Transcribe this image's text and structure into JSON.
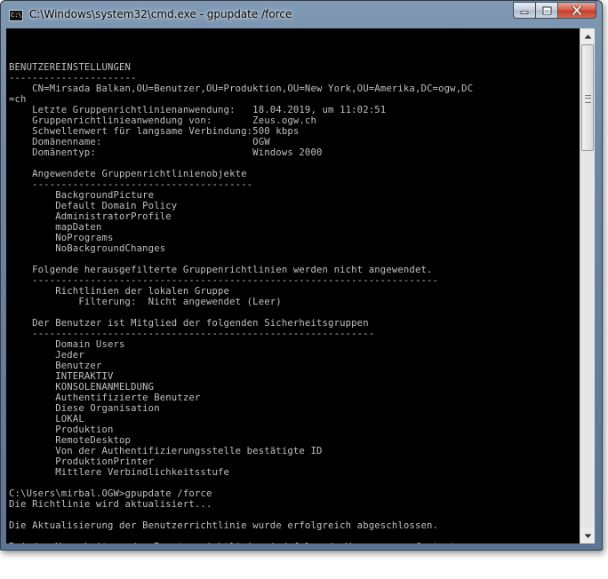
{
  "window": {
    "title": "C:\\Windows\\system32\\cmd.exe - gpupdate  /force",
    "icon": "C:\\",
    "buttons": {
      "minimize": "minimize-icon",
      "maximize": "maximize-icon",
      "close": "close-icon"
    }
  },
  "console": {
    "lines": [
      "",
      "",
      "",
      "BENUTZEREINSTELLUNGEN",
      "----------------------",
      "    CN=Mirsada Balkan,OU=Benutzer,OU=Produktion,OU=New York,OU=Amerika,DC=ogw,DC",
      "=ch",
      "    Letzte Gruppenrichtlinienanwendung:   18.04.2019, um 11:02:51",
      "    Gruppenrichtlinieanwendung von:       Zeus.ogw.ch",
      "    Schwellenwert für langsame Verbindung:500 kbps",
      "    Domänenname:                          OGW",
      "    Domänentyp:                           Windows 2000",
      "",
      "    Angewendete Gruppenrichtlinienobjekte",
      "    --------------------------------------",
      "        BackgroundPicture",
      "        Default Domain Policy",
      "        AdministratorProfile",
      "        mapDaten",
      "        NoPrograms",
      "        NoBackgroundChanges",
      "",
      "    Folgende herausgefilterte Gruppenrichtlinien werden nicht angewendet.",
      "    ----------------------------------------------------------------------",
      "        Richtlinien der lokalen Gruppe",
      "            Filterung:  Nicht angewendet (Leer)",
      "",
      "    Der Benutzer ist Mitglied der folgenden Sicherheitsgruppen",
      "    -----------------------------------------------------------",
      "        Domain Users",
      "        Jeder",
      "        Benutzer",
      "        INTERAKTIV",
      "        KONSOLENANMELDUNG",
      "        Authentifizierte Benutzer",
      "        Diese Organisation",
      "        LOKAL",
      "        Produktion",
      "        RemoteDesktop",
      "        Von der Authentifizierungsstelle bestätigte ID",
      "        ProduktionPrinter",
      "        Mittlere Verbindlichkeitsstufe",
      "",
      "C:\\Users\\mirbal.OGW>gpupdate /force",
      "Die Richtlinie wird aktualisiert...",
      "",
      "Die Aktualisierung der Benutzerrichtlinie wurde erfolgreich abgeschlossen.",
      "",
      "Bei der Verarbeitung der Benutzerrichtlinie sind folgende Warnungen aufgetreten:"
    ]
  },
  "scrollbar": {
    "up": "scroll-up-arrow-icon",
    "down": "scroll-down-arrow-icon"
  },
  "colors": {
    "console_bg": "#000000",
    "console_fg": "#c0c0c0",
    "close_red": "#c4402a"
  }
}
